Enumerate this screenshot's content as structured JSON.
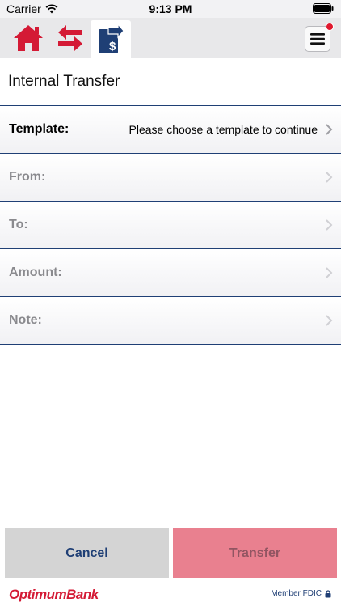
{
  "status_bar": {
    "carrier": "Carrier",
    "time": "9:13 PM"
  },
  "nav": {
    "icons": [
      "home-icon",
      "transfer-arrows-icon",
      "internal-transfer-icon",
      "hamburger-menu-icon"
    ],
    "brand_color": "#d41a35",
    "accent_color": "#1f3f75"
  },
  "page": {
    "title": "Internal Transfer"
  },
  "form": {
    "template": {
      "label": "Template:",
      "value": "Please choose a template to continue"
    },
    "from": {
      "label": "From:"
    },
    "to": {
      "label": "To:"
    },
    "amount": {
      "label": "Amount:"
    },
    "note": {
      "label": "Note:"
    }
  },
  "actions": {
    "cancel_label": "Cancel",
    "transfer_label": "Transfer"
  },
  "footer": {
    "logo_text": "OptimumBank",
    "fdic_text": "Member FDIC"
  }
}
